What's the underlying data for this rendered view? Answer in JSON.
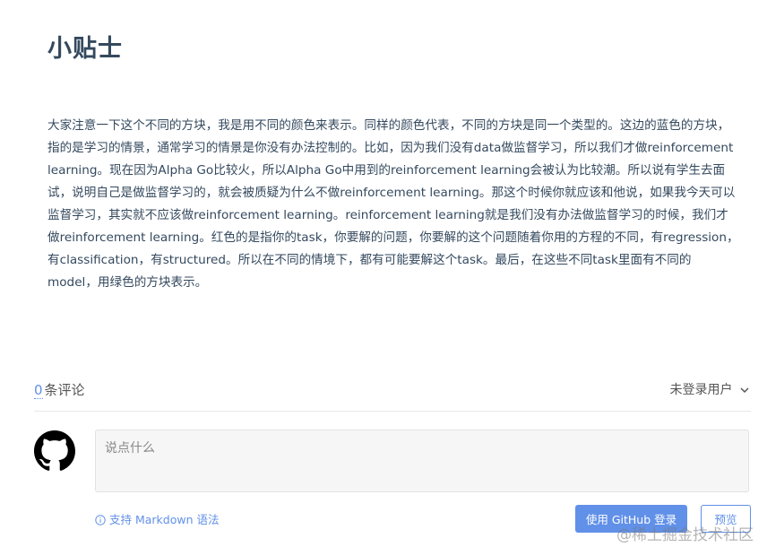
{
  "article": {
    "title": "小贴士",
    "paragraph": "大家注意一下这个不同的方块，我是用不同的颜色来表示。同样的颜色代表，不同的方块是同一个类型的。这边的蓝色的方块，指的是学习的情景，通常学习的情景是你没有办法控制的。比如，因为我们没有data做监督学习，所以我们才做reinforcement learning。现在因为Alpha Go比较火，所以Alpha Go中用到的reinforcement learning会被认为比较潮。所以说有学生去面试，说明自己是做监督学习的，就会被质疑为什么不做reinforcement learning。那这个时候你就应该和他说，如果我今天可以监督学习，其实就不应该做reinforcement learning。reinforcement learning就是我们没有办法做监督学习的时候，我们才做reinforcement learning。红色的是指你的task，你要解的问题，你要解的这个问题随着你用的方程的不同，有regression，有classification，有structured。所以在不同的情境下，都有可能要解这个task。最后，在这些不同task里面有不同的model，用绿色的方块表示。"
  },
  "comments": {
    "count": "0",
    "count_label": "条评论",
    "user_menu_label": "未登录用户",
    "editor_placeholder": "说点什么",
    "markdown_tip": "支持 Markdown 语法",
    "login_button": "使用 GitHub 登录",
    "preview_button": "预览"
  },
  "watermark": "@稀土掘金技术社区",
  "colors": {
    "accent": "#6190e8",
    "text": "#34495e"
  },
  "icons": {
    "avatar": "github-icon",
    "dropdown": "chevron-down-icon",
    "info": "info-icon"
  }
}
